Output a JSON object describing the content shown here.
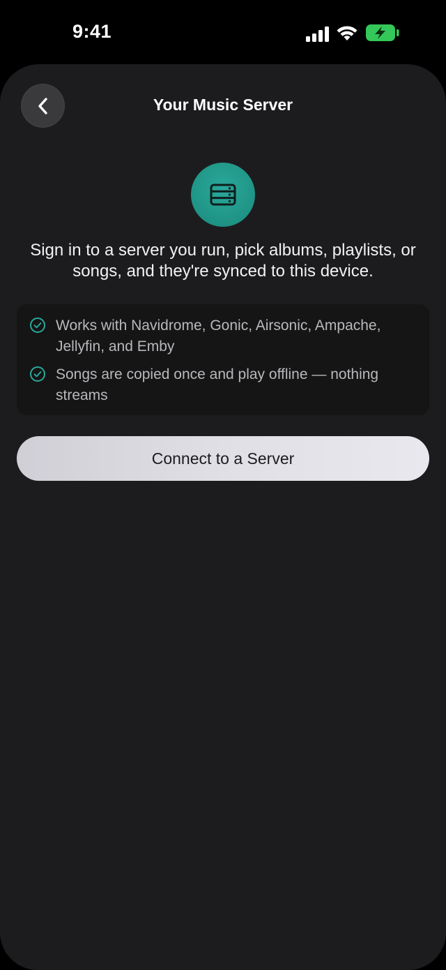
{
  "status_bar": {
    "time": "9:41",
    "icons": [
      "signal-icon",
      "wifi-icon",
      "battery-charging-icon"
    ],
    "battery_color": "#34c759"
  },
  "header": {
    "title": "Your Music Server",
    "back_icon": "chevron-left-icon"
  },
  "hero": {
    "icon": "server-icon",
    "accent_color": "#1f9385"
  },
  "intro": {
    "text": "Sign in to a server you run, pick albums, playlists, or songs, and they're synced to this device."
  },
  "features": [
    {
      "icon": "check-circle-icon",
      "text": "Works with Navidrome, Gonic, Airsonic, Ampache, Jellyfin, and Emby"
    },
    {
      "icon": "check-circle-icon",
      "text": "Songs are copied once and play offline — nothing streams"
    }
  ],
  "actions": {
    "connect_label": "Connect to a Server"
  }
}
